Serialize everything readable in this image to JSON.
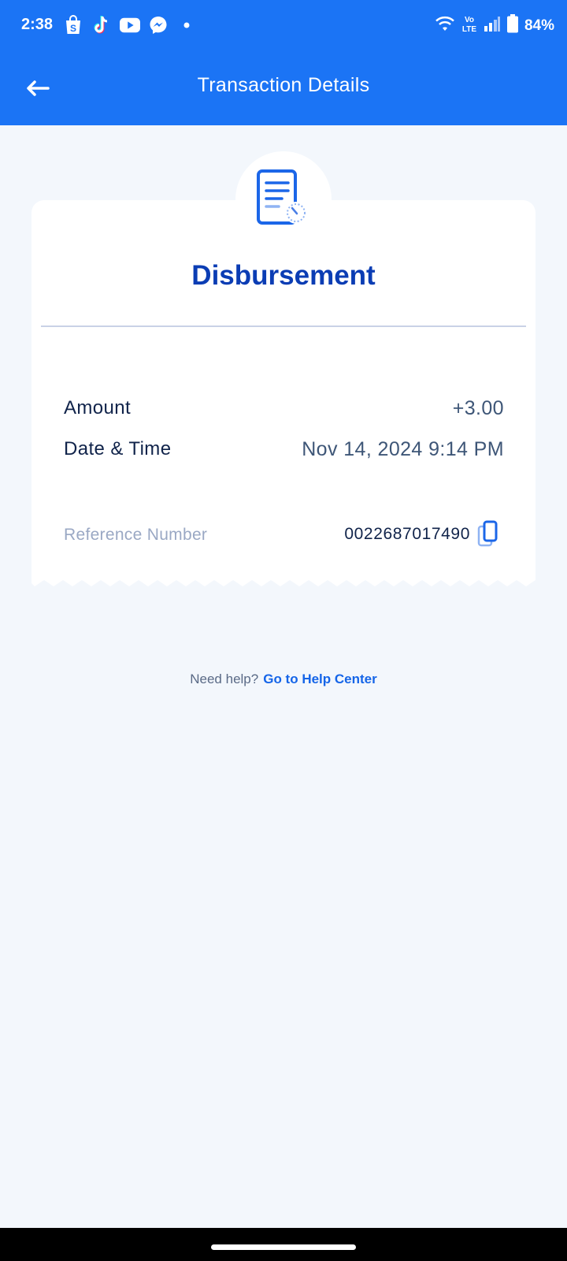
{
  "status_bar": {
    "time": "2:38",
    "battery": "84%",
    "app_icons": [
      "shopee-icon",
      "tiktok-icon",
      "youtube-icon",
      "messenger-icon",
      "dot-icon"
    ],
    "system_icons": [
      "wifi-icon",
      "volte-icon",
      "signal-icon",
      "battery-icon"
    ]
  },
  "header": {
    "title": "Transaction Details",
    "back_icon": "arrow-left-icon"
  },
  "receipt": {
    "icon": "receipt-clock-icon",
    "title": "Disbursement",
    "rows": [
      {
        "label": "Amount",
        "value": "+3.00"
      },
      {
        "label": "Date & Time",
        "value": "Nov 14, 2024 9:14 PM"
      }
    ],
    "reference": {
      "label": "Reference Number",
      "value": "0022687017490",
      "copy_icon": "copy-icon"
    }
  },
  "help": {
    "text": "Need help?",
    "link": "Go to Help Center"
  },
  "colors": {
    "header_bg": "#1b74f5",
    "title": "#0b3db4",
    "page_bg": "#f3f7fc",
    "link": "#1565e8"
  }
}
